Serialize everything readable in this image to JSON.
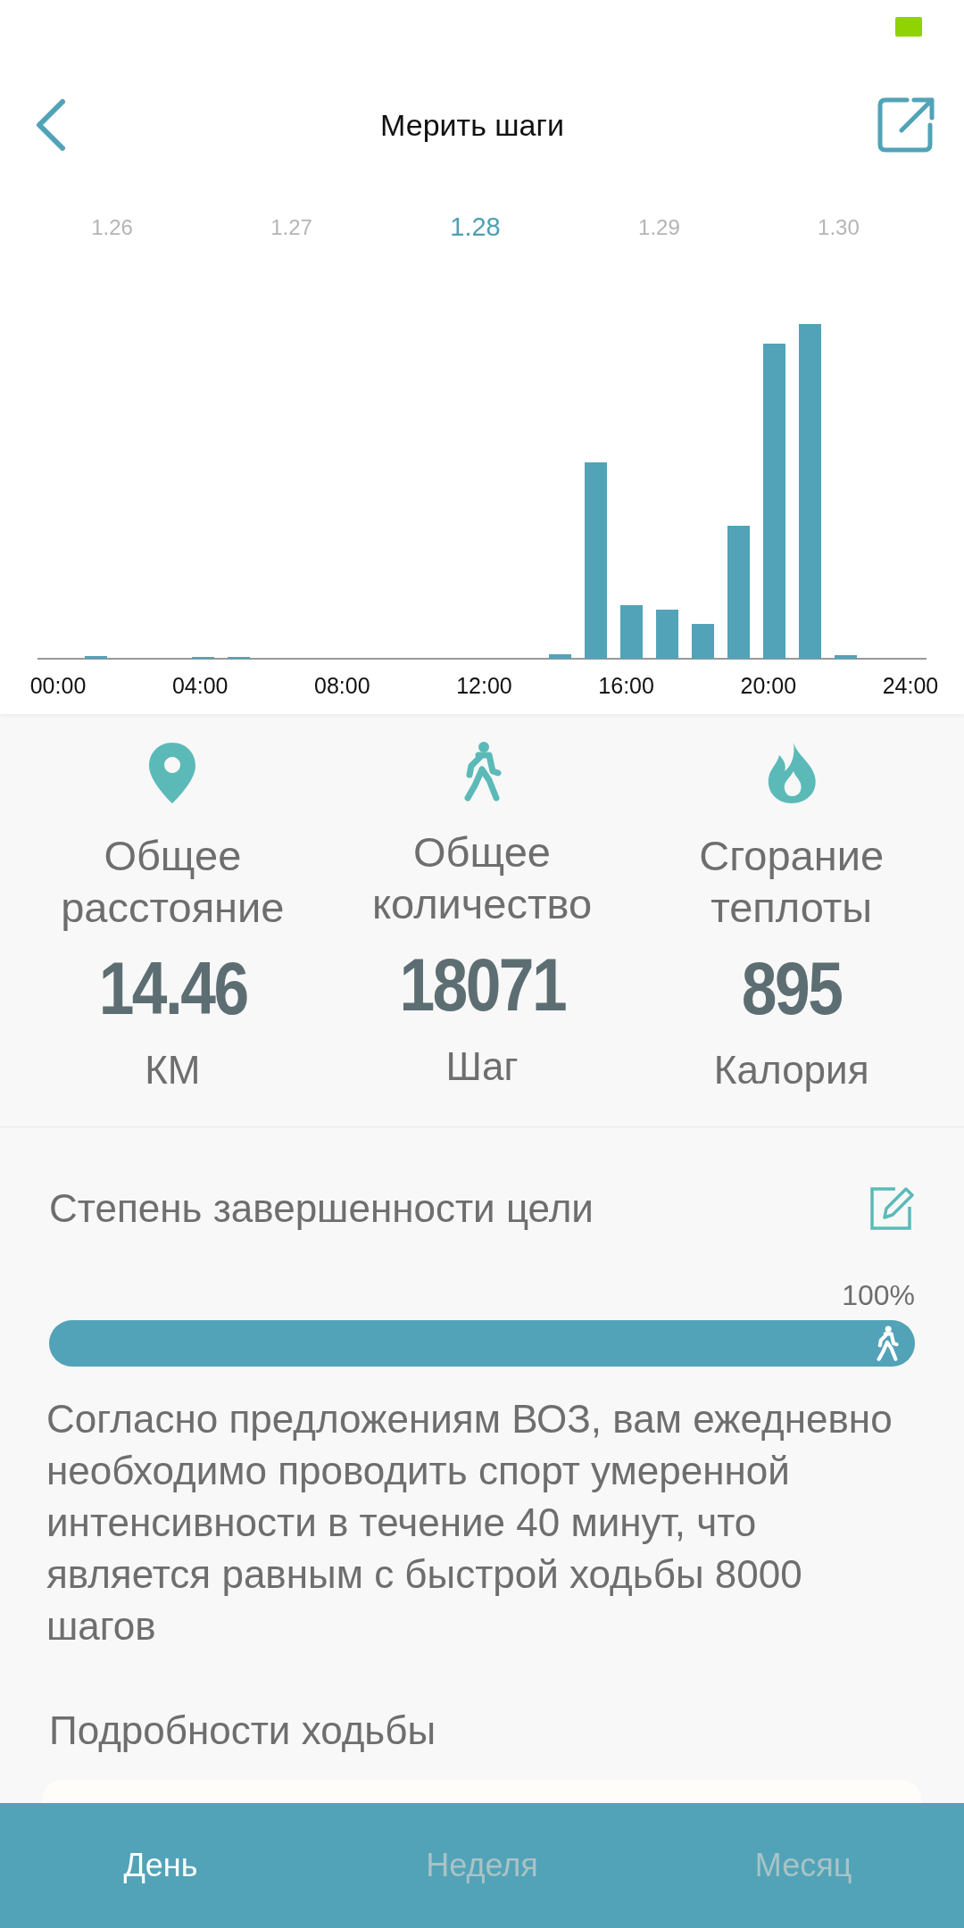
{
  "header": {
    "title": "Мерить шаги"
  },
  "dates": [
    {
      "label": "1.26",
      "selected": false
    },
    {
      "label": "1.27",
      "selected": false
    },
    {
      "label": "1.28",
      "selected": true
    },
    {
      "label": "1.29",
      "selected": false
    },
    {
      "label": "1.30",
      "selected": false
    }
  ],
  "chart": {
    "x_labels": [
      "00:00",
      "04:00",
      "08:00",
      "12:00",
      "16:00",
      "20:00",
      "24:00"
    ]
  },
  "stats": [
    {
      "kind": "distance",
      "label": "Общее расстояние",
      "value": "14.46",
      "unit": "КМ"
    },
    {
      "kind": "steps",
      "label": "Общее количество",
      "value": "18071",
      "unit": "Шаг"
    },
    {
      "kind": "calories",
      "label": "Сгорание теплоты",
      "value": "895",
      "unit": "Калория"
    }
  ],
  "goal": {
    "title": "Степень завершенности цели",
    "percent": "100%",
    "level": 1.0,
    "note": "Согласно предложениям ВОЗ, вам ежедневно необходимо проводить спорт умеренной интенсивности в течение 40 минут, что является равным с быстрой ходьбы 8000 шагов"
  },
  "details": {
    "title": "Подробности ходьбы"
  },
  "bottom_tabs": [
    {
      "label": "День",
      "selected": true
    },
    {
      "label": "Неделя",
      "selected": false
    },
    {
      "label": "Месяц",
      "selected": false
    }
  ]
}
